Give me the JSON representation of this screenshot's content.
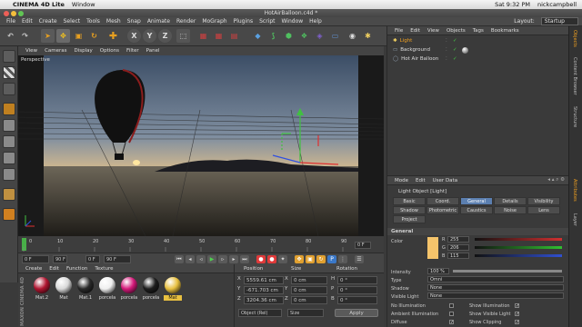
{
  "mac_menu": {
    "apple": "",
    "app": "CINEMA 4D Lite",
    "window": "Window",
    "clock": "Sat 9:32 PM",
    "user": "nickcampbell"
  },
  "window_title": "HotAirBalloon.c4d *",
  "layout": {
    "label": "Layout:",
    "value": "Startup"
  },
  "main_menu": [
    "File",
    "Edit",
    "Create",
    "Select",
    "Tools",
    "Mesh",
    "Snap",
    "Animate",
    "Render",
    "MoGraph",
    "Plugins",
    "Script",
    "Window",
    "Help"
  ],
  "toolbar": {
    "move": "✥",
    "scale": "▣",
    "rotate": "↻",
    "x": "X",
    "y": "Y",
    "z": "Z"
  },
  "viewport": {
    "menu": [
      "View",
      "Cameras",
      "Display",
      "Options",
      "Filter",
      "Panel"
    ],
    "label": "Perspective"
  },
  "timeline": {
    "ticks": [
      "0",
      "10",
      "20",
      "30",
      "40",
      "50",
      "60",
      "70",
      "80",
      "90"
    ],
    "frame": "0 F"
  },
  "transport": {
    "start": "0 F",
    "end": "90 F",
    "current": "0 F",
    "end2": "90 F"
  },
  "materials": {
    "menu": [
      "Create",
      "Edit",
      "Function",
      "Texture"
    ],
    "items": [
      {
        "name": "Mat.2",
        "color": "#b01530"
      },
      {
        "name": "Mat",
        "color": "#d8d8d8"
      },
      {
        "name": "Mat.1",
        "color": "#2a2a2a"
      },
      {
        "name": "porcela",
        "color": "#f0f0f0"
      },
      {
        "name": "porcela",
        "color": "#d41a7a"
      },
      {
        "name": "porcela",
        "color": "#1e1e1e"
      },
      {
        "name": "Mat",
        "color": "#e8c040"
      }
    ],
    "brand": "MAXON CINEMA 4D"
  },
  "coordinates": {
    "headers": [
      "Position",
      "Size",
      "Rotation"
    ],
    "rows": [
      {
        "axis": "X",
        "pos": "5559.61 cm",
        "size_axis": "X",
        "size": "0 cm",
        "rot_axis": "H",
        "rot": "0 °"
      },
      {
        "axis": "Y",
        "pos": "-671.703 cm",
        "size_axis": "Y",
        "size": "0 cm",
        "rot_axis": "P",
        "rot": "0 °"
      },
      {
        "axis": "Z",
        "pos": "3204.36 cm",
        "size_axis": "Z",
        "size": "0 cm",
        "rot_axis": "B",
        "rot": "0 °"
      }
    ],
    "mode": "Object (Rel)",
    "size_mode": "Size",
    "apply": "Apply"
  },
  "objects": {
    "menu": [
      "File",
      "Edit",
      "View",
      "Objects",
      "Tags",
      "Bookmarks"
    ],
    "items": [
      {
        "name": "Light",
        "selected": true
      },
      {
        "name": "Background",
        "selected": false
      },
      {
        "name": "Hot Air Balloon",
        "selected": false
      }
    ]
  },
  "attributes": {
    "menu": [
      "Mode",
      "Edit",
      "User Data"
    ],
    "title": "Light Object [Light]",
    "tabs_row1": [
      "Basic",
      "Coord.",
      "General",
      "Details",
      "Visibility"
    ],
    "tabs_row2": [
      "Shadow",
      "Photometric",
      "Caustics",
      "Noise",
      "Lens"
    ],
    "tabs_row3": [
      "Project"
    ],
    "active_tab": "General",
    "section": "General",
    "color_label": "Color",
    "swatch": "#f5c46b",
    "rgb": [
      {
        "ch": "R",
        "val": "255"
      },
      {
        "ch": "G",
        "val": "206"
      },
      {
        "ch": "B",
        "val": "115"
      }
    ],
    "intensity_label": "Intensity",
    "intensity": "100 %",
    "type_label": "Type",
    "type": "Omni",
    "shadow_label": "Shadow",
    "shadow": "None",
    "visible_label": "Visible Light",
    "visible": "None",
    "no_illum": "No Illumination",
    "show_illum": "Show Illumination",
    "ambient": "Ambient Illumination",
    "show_vis": "Show Visible Light",
    "diffuse": "Diffuse",
    "show_clip": "Show Clipping"
  },
  "right_tabs": [
    "Objects",
    "Content Browser",
    "Structure",
    "Attributes",
    "Layer"
  ]
}
